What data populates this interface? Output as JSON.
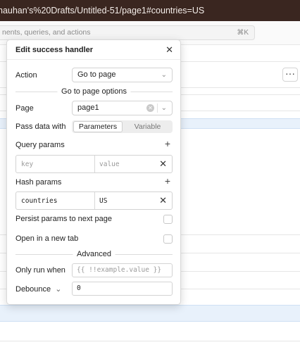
{
  "browser": {
    "url_fragment": "hauhan's%20Drafts/Untitled-51/page1#countries=US"
  },
  "appbar": {
    "search_placeholder": "nents, queries, and actions",
    "search_shortcut": "⌘K",
    "more_button": "···"
  },
  "modal": {
    "title": "Edit success handler",
    "close_icon": "✕",
    "action_label": "Action",
    "action_value": "Go to page",
    "section_options": "Go to page options",
    "page_label": "Page",
    "page_value": "page1",
    "pass_data_label": "Pass data with",
    "pass_data_options": [
      "Parameters",
      "Variable"
    ],
    "pass_data_selected": "Parameters",
    "query_params_label": "Query params",
    "query_params": {
      "key_placeholder": "key",
      "value_placeholder": "value"
    },
    "hash_params_label": "Hash params",
    "hash_params": {
      "key": "countries",
      "value": "US"
    },
    "persist_label": "Persist params to next page",
    "persist_checked": false,
    "new_tab_label": "Open in a new tab",
    "new_tab_checked": false,
    "section_advanced": "Advanced",
    "only_run_label": "Only run when",
    "only_run_placeholder": "{{ !!example.value }}",
    "debounce_label": "Debounce",
    "debounce_value": "0"
  },
  "icons": {
    "close": "close-icon",
    "chevron": "chevron-down-icon",
    "plus": "plus-icon",
    "clear": "clear-icon",
    "more": "more-icon"
  }
}
